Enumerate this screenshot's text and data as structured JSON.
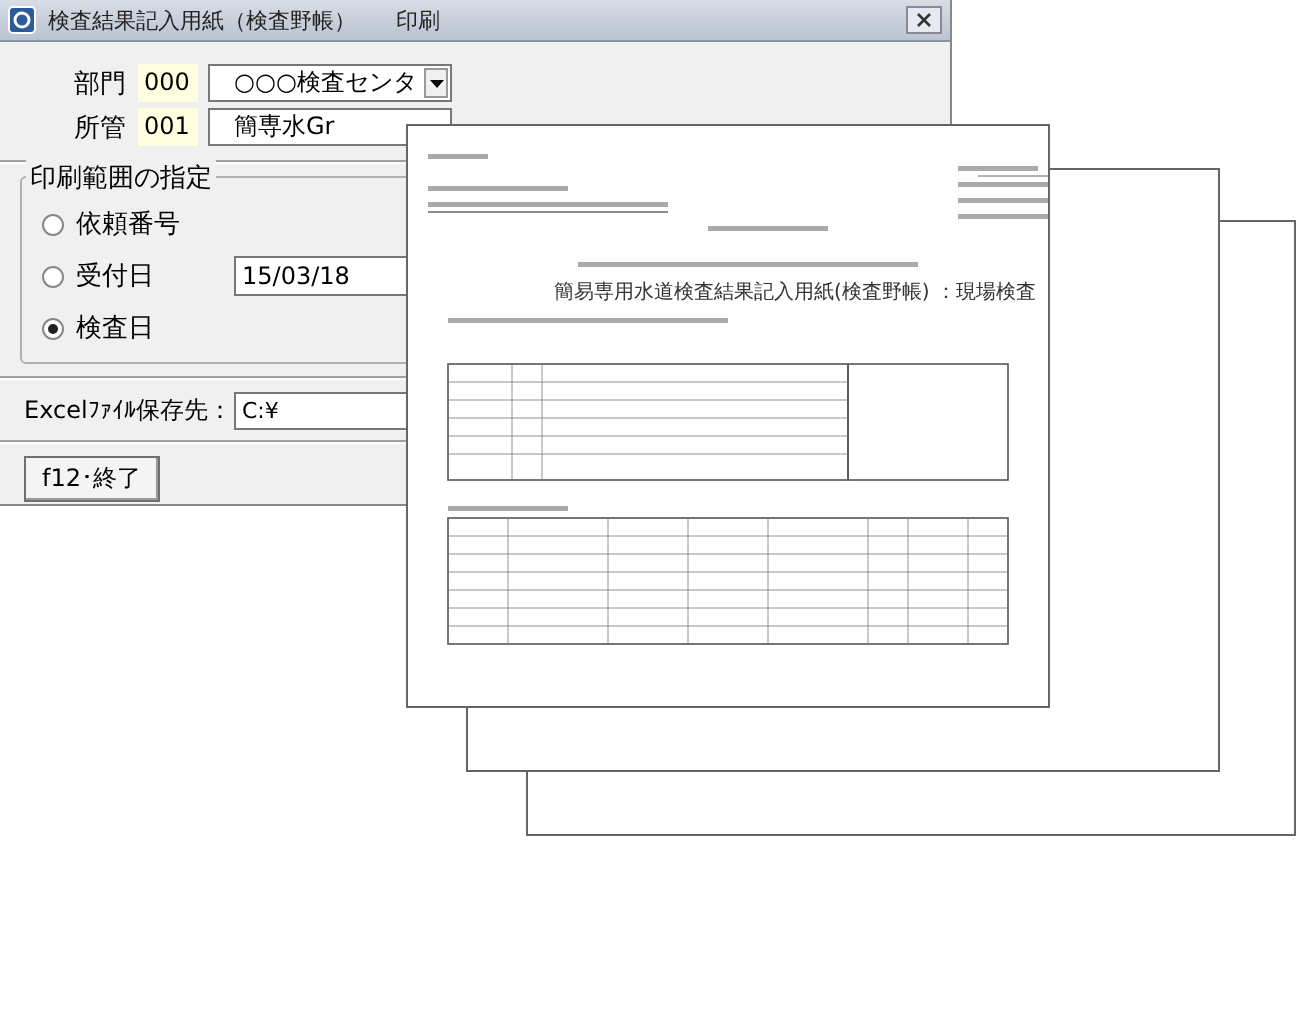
{
  "window": {
    "title": "検査結果記入用紙（検査野帳）",
    "menu": [
      "印刷"
    ]
  },
  "department": {
    "label": "部門",
    "code": "000",
    "value": "○○○検査センタ"
  },
  "jurisdiction": {
    "label": "所管",
    "code": "001",
    "value": "簡専水Gr"
  },
  "print_range": {
    "title": "印刷範囲の指定",
    "options": [
      {
        "label": "依頼番号",
        "selected": false
      },
      {
        "label": "受付日",
        "selected": false,
        "value": "15/03/18"
      },
      {
        "label": "検査日",
        "selected": true
      }
    ]
  },
  "excel": {
    "label": "Excelﾌｧｲﾙ保存先：",
    "value": "C:¥"
  },
  "buttons": [
    "f12･終了"
  ],
  "preview": {
    "title": "簡易専用水道検査結果記入用紙(検査野帳) ：現場検査"
  }
}
